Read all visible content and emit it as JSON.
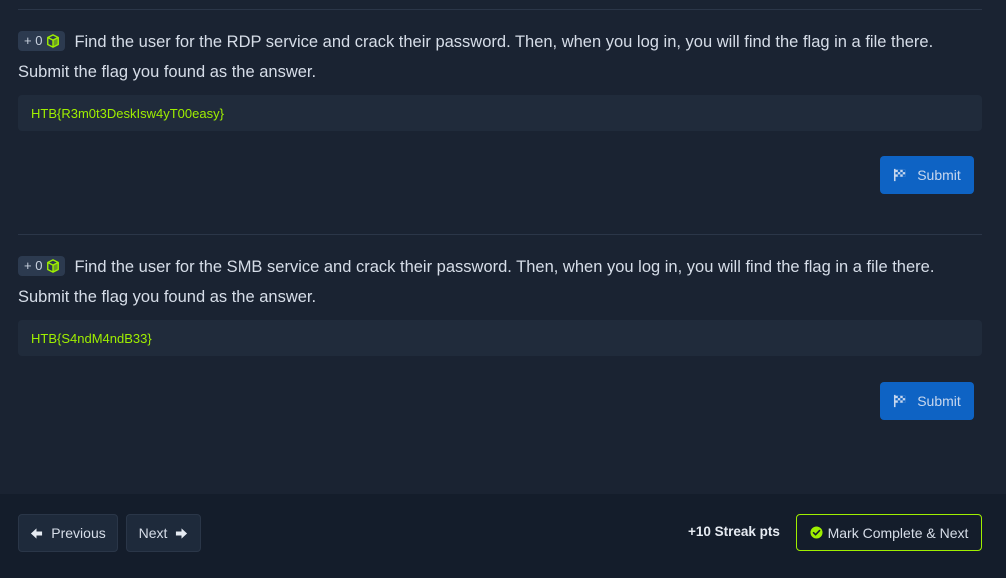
{
  "questions": [
    {
      "points_badge": "+ 0",
      "badge_icon": "cube-icon",
      "text": "Find the user for the RDP service and crack their password. Then, when you log in, you will find the flag in a file there. Submit the flag you found as the answer.",
      "answer": "HTB{R3m0t3DeskIsw4yT00easy}",
      "submit_label": "Submit"
    },
    {
      "points_badge": "+ 0",
      "badge_icon": "cube-icon",
      "text": "Find the user for the SMB service and crack their password. Then, when you log in, you will find the flag in a file there. Submit the flag you found as the answer.",
      "answer": "HTB{S4ndM4ndB33}",
      "submit_label": "Submit"
    }
  ],
  "footer": {
    "previous_label": "Previous",
    "next_label": "Next",
    "streak": "+10 Streak pts",
    "mark_complete_label": "Mark Complete & Next"
  },
  "colors": {
    "background": "#1a2332",
    "footer_background": "#141d2b",
    "accent_green": "#9fef00",
    "submit_blue": "#0e63c4"
  }
}
